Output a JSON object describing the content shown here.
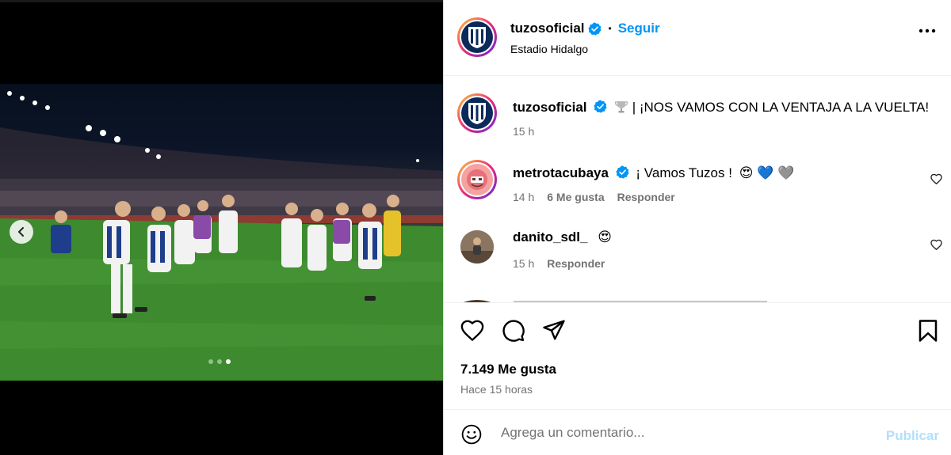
{
  "post": {
    "account": "tuzosoficial",
    "follow_label": "Seguir",
    "separator": "•",
    "location": "Estadio Hidalgo",
    "caption": "| ¡NOS VAMOS CON LA VENTAJA A LA VUELTA!",
    "caption_time": "15 h",
    "likes": "7.149 Me gusta",
    "posted_ago": "Hace 15 horas",
    "carousel": {
      "slides": 3,
      "active_index": 2
    }
  },
  "comments": [
    {
      "user": "metrotacubaya",
      "verified": true,
      "text": "¡ Vamos Tuzos !",
      "emojis": "😍 💙 🩶",
      "time": "14 h",
      "likes": "6 Me gusta",
      "reply": "Responder"
    },
    {
      "user": "danito_sdl_",
      "verified": false,
      "text": "",
      "emojis": "😍",
      "time": "15 h",
      "reply": "Responder"
    }
  ],
  "composer": {
    "placeholder": "Agrega un comentario...",
    "publish": "Publicar"
  },
  "colors": {
    "link_blue": "#0095f6",
    "publish_disabled": "#b2dffc",
    "muted": "#737373"
  }
}
